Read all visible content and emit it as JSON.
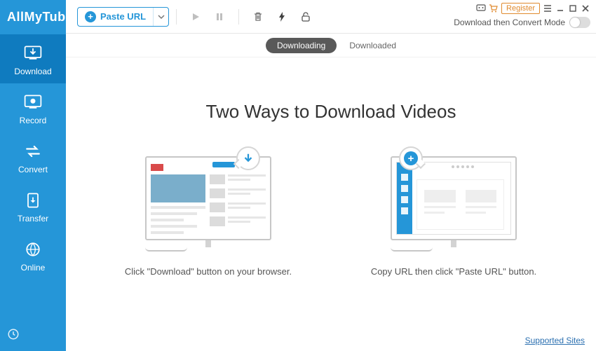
{
  "app_title": "AllMyTube",
  "sidebar": {
    "items": [
      {
        "label": "Download"
      },
      {
        "label": "Record"
      },
      {
        "label": "Convert"
      },
      {
        "label": "Transfer"
      },
      {
        "label": "Online"
      }
    ]
  },
  "toolbar": {
    "paste_label": "Paste URL",
    "register_label": "Register",
    "convert_mode_label": "Download then Convert Mode"
  },
  "tabs": {
    "downloading": "Downloading",
    "downloaded": "Downloaded"
  },
  "content": {
    "headline": "Two Ways to Download Videos",
    "caption_left": "Click \"Download\" button on your browser.",
    "caption_right": "Copy URL then click \"Paste URL\" button."
  },
  "footer": {
    "supported_sites": "Supported Sites"
  }
}
